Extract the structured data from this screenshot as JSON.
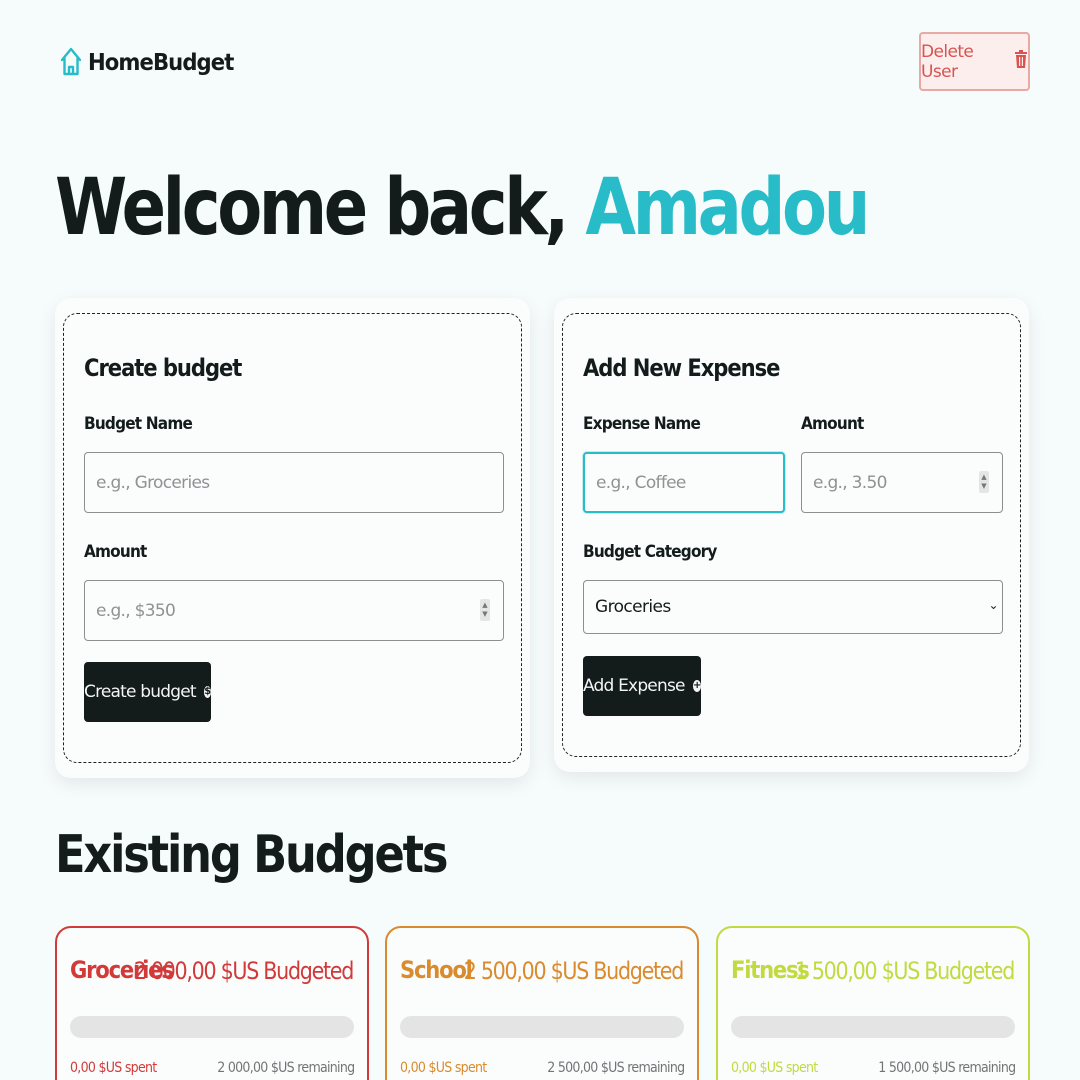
{
  "header": {
    "app_name": "HomeBudget",
    "logo_icon": "home-icon",
    "delete_user_label": "Delete User",
    "delete_icon": "trash-icon"
  },
  "welcome": {
    "prefix": "Welcome back,",
    "user_name": "Amadou"
  },
  "create_budget": {
    "title": "Create budget",
    "name_label": "Budget Name",
    "name_placeholder": "e.g., Groceries",
    "amount_label": "Amount",
    "amount_placeholder": "e.g., $350",
    "button_label": "Create budget",
    "button_icon": "dollar-circle-icon"
  },
  "add_expense": {
    "title": "Add New Expense",
    "name_label": "Expense Name",
    "name_placeholder": "e.g., Coffee",
    "amount_label": "Amount",
    "amount_placeholder": "e.g., 3.50",
    "category_label": "Budget Category",
    "category_selected": "Groceries",
    "button_label": "Add Expense",
    "button_icon": "plus-circle-icon"
  },
  "existing": {
    "title": "Existing Budgets",
    "budgets": [
      {
        "name": "Groceries",
        "budgeted": "2 000,00 $US Budgeted",
        "spent": "0,00 $US spent",
        "remaining": "2 000,00 $US remaining",
        "progress": 0,
        "color": "#d23a3a"
      },
      {
        "name": "School",
        "budgeted": "2 500,00 $US Budgeted",
        "spent": "0,00 $US spent",
        "remaining": "2 500,00 $US remaining",
        "progress": 0,
        "color": "#d98b2e"
      },
      {
        "name": "Fitness",
        "budgeted": "1 500,00 $US Budgeted",
        "spent": "0,00 $US spent",
        "remaining": "1 500,00 $US remaining",
        "progress": 0,
        "color": "#c2d93f"
      }
    ]
  },
  "colors": {
    "accent": "#27bcc8",
    "dark": "#141b1b",
    "danger": "#d9534f"
  }
}
